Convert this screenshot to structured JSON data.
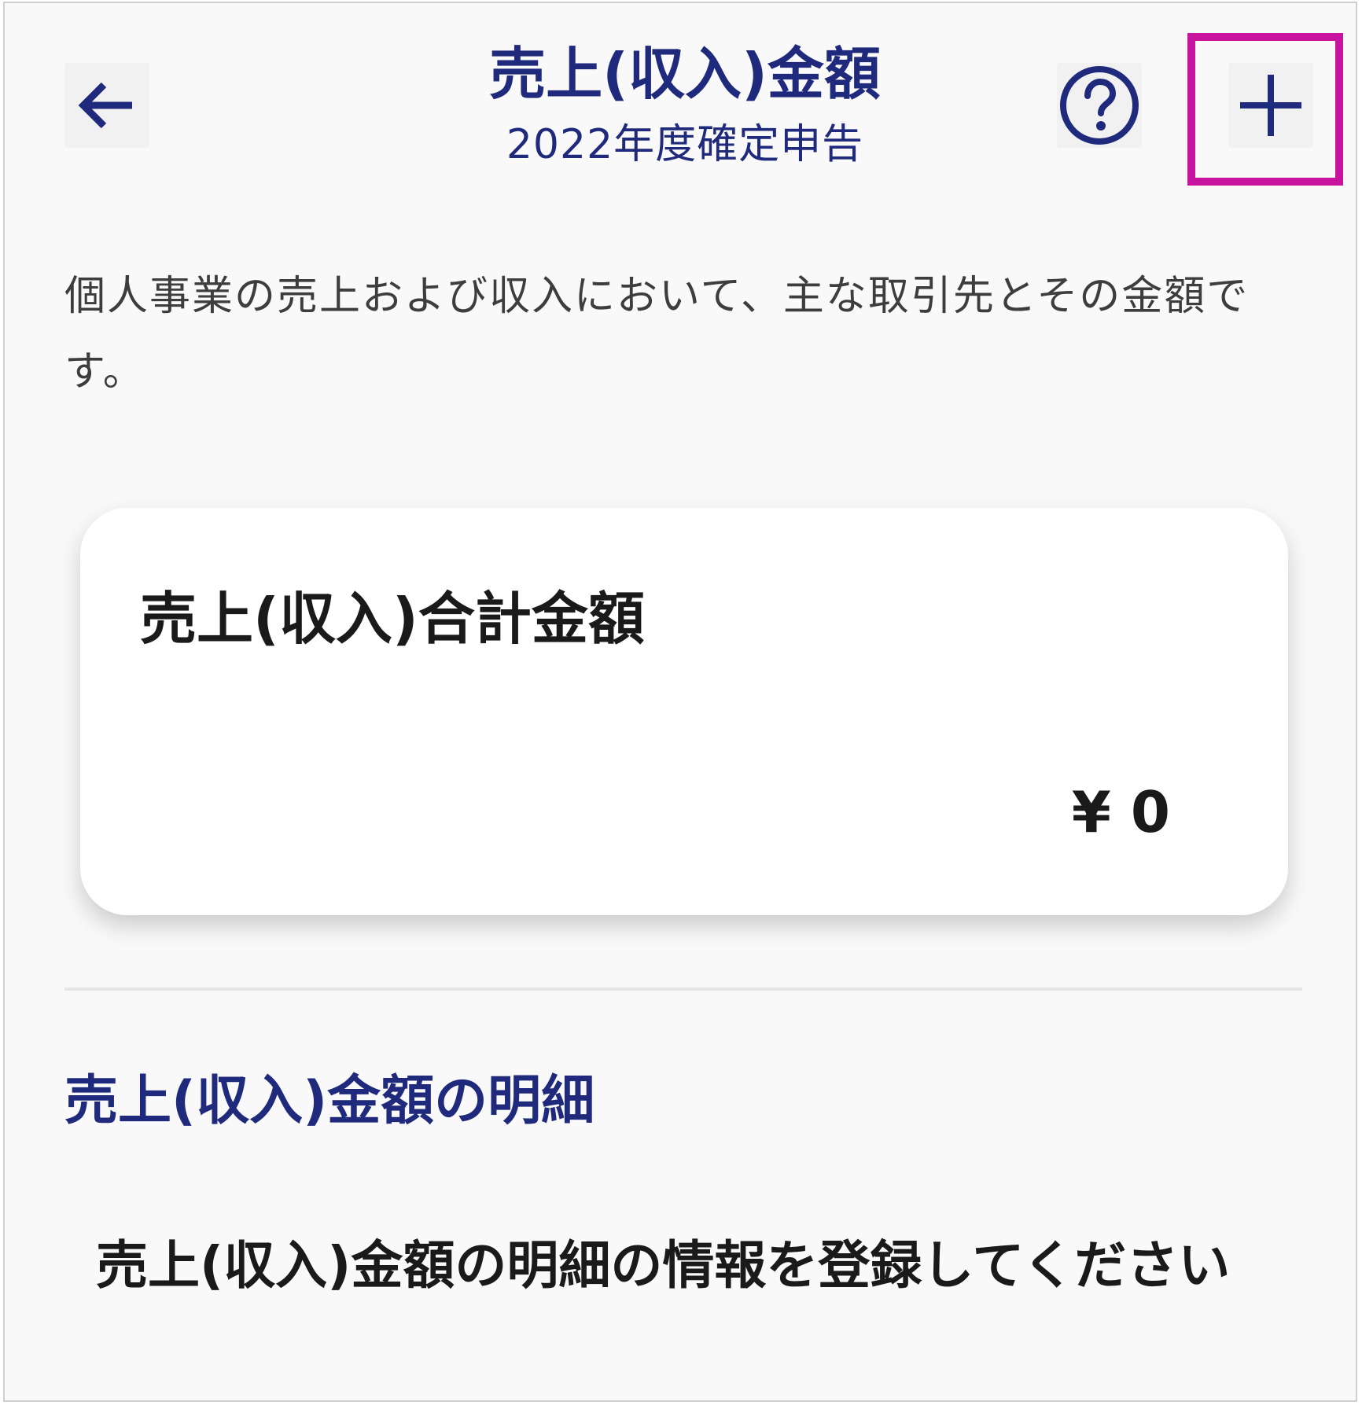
{
  "header": {
    "title": "売上(収入)金額",
    "subtitle": "2022年度確定申告",
    "back_icon": "arrow-left-icon",
    "help_icon": "question-circle-icon",
    "add_icon": "plus-icon"
  },
  "description": "個人事業の売上および収入において、主な取引先とその金額です。",
  "total_card": {
    "label": "売上(収入)合計金額",
    "amount": "¥ 0"
  },
  "details": {
    "heading": "売上(収入)金額の明細",
    "empty_message": "売上(収入)金額の明細の情報を登録してください"
  },
  "colors": {
    "primary": "#202a7c",
    "highlight": "#c8139f",
    "background": "#f9f9fa",
    "card": "#ffffff",
    "text": "#1a1a1a"
  }
}
